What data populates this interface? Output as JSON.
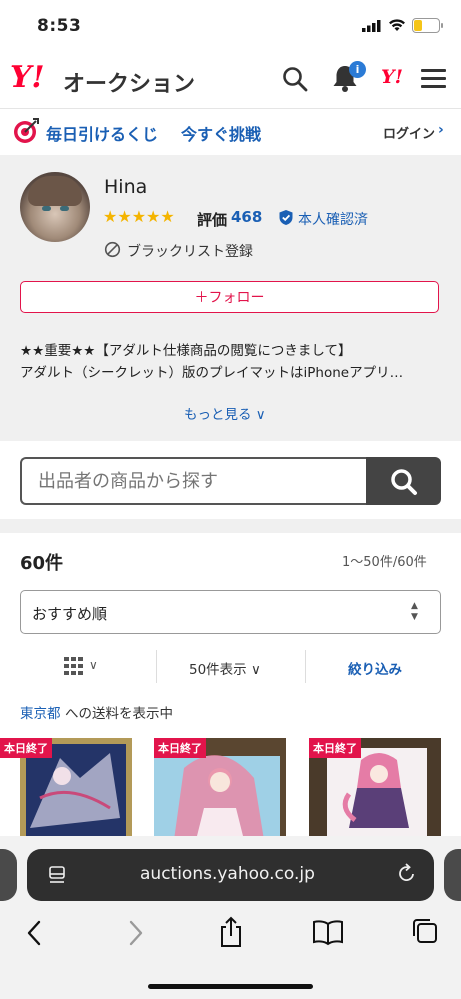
{
  "status": {
    "time": "8:53"
  },
  "header": {
    "logo_mark": "Y!",
    "logo_text": "オークション",
    "notification_badge": "i",
    "yj_mark": "Y!"
  },
  "promo": {
    "text1": "毎日引けるくじ",
    "text2": "今すぐ挑戦",
    "login": "ログイン",
    "login_chevron": "›"
  },
  "seller": {
    "name": "Hina",
    "stars": "★★★★★",
    "rating_label": "評価",
    "rating_count": "468",
    "verified": "本人確認済",
    "blacklist": "ブラックリスト登録",
    "follow": "＋フォロー",
    "desc_line1": "★★重要★★【アダルト仕様商品の閲覧につきまして】",
    "desc_line2": "アダルト（シークレット）版のプレイマットはiPhoneアプリ…",
    "more": "もっと見る ∨"
  },
  "search": {
    "placeholder": "出品者の商品から探す"
  },
  "results": {
    "count": "60件",
    "range": "1〜50件/60件",
    "sort": "おすすめ順",
    "per_page": "50件表示 ∨",
    "filter": "絞り込み",
    "ship_location": "東京都",
    "ship_text": "への送料を表示中"
  },
  "items": [
    {
      "badge": "本日終了",
      "color1": "#2b3a6b",
      "color2": "#c7b06a"
    },
    {
      "badge": "本日終了",
      "color1": "#e7a6b6",
      "color2": "#8ec6e0"
    },
    {
      "badge": "本日終了",
      "color1": "#f1c9d6",
      "color2": "#6b4a78"
    }
  ],
  "browser": {
    "url": "auctions.yahoo.co.jp"
  },
  "colors": {
    "accent": "#1a5fb4",
    "brand_red": "#ff0033",
    "follow_red": "#e2144b",
    "star": "#f4b400"
  }
}
